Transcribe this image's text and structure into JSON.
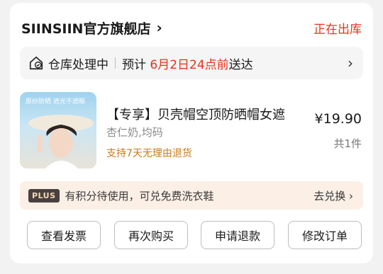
{
  "shop": {
    "name": "SIINSIIN官方旗舰店",
    "chevron": "›",
    "status": "正在出库"
  },
  "logistics": {
    "icon": "house-check-icon",
    "state": "仓库处理中",
    "prefix": "预计",
    "date": "6月2日24点前",
    "suffix": "送达",
    "chevron": "›"
  },
  "product": {
    "image_tag": "原纱防晒 遮光不遮眼",
    "title": "【专享】贝壳帽空顶防晒帽女遮",
    "spec": "杏仁奶,均码",
    "policy": "支持7天无理由退货",
    "price": "¥19.90",
    "quantity": "共1件"
  },
  "plus": {
    "badge": "PLUS",
    "text": "有积分待使用，可兑免费洗衣鞋",
    "link": "去兑换 ›"
  },
  "actions": [
    "查看发票",
    "再次购买",
    "申请退款",
    "修改订单"
  ],
  "colors": {
    "accent": "#e8321e",
    "policy": "#c97a1a",
    "plus_bg": "#fcefe6"
  }
}
